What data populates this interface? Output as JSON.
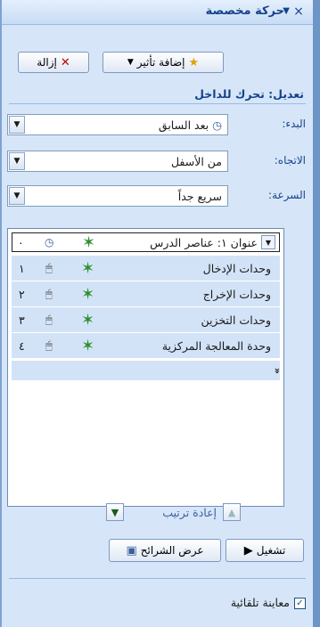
{
  "panel": {
    "title": "حركة مخصصة",
    "close_glyph": "×",
    "menu_glyph": "▼"
  },
  "toolbar": {
    "add_effect_label": "إضافة تأثير",
    "remove_label": "إزالة"
  },
  "section": {
    "title": "تعديل: تحرك للداخل"
  },
  "fields": {
    "start_label": "البدء:",
    "start_value": "بعد السابق",
    "direction_label": "الاتجاه:",
    "direction_value": "من الأسفل",
    "speed_label": "السرعة:",
    "speed_value": "سريع جداً"
  },
  "list": {
    "header_label": "عنوان ١: عناصر الدرس",
    "header_num": "٠",
    "items": [
      {
        "label": "وحدات الإدخال",
        "num": "١"
      },
      {
        "label": "وحدات الإخراج",
        "num": "٢"
      },
      {
        "label": "وحدات التخزين",
        "num": "٣"
      },
      {
        "label": "وحدة المعالجة المركزية",
        "num": "٤"
      }
    ],
    "collapse_glyph": "»"
  },
  "reorder": {
    "label": "إعادة ترتيب"
  },
  "actions": {
    "play_label": "تشغيل",
    "slideshow_label": "عرض الشرائح"
  },
  "autopreview": {
    "label": "معاينة تلقائية",
    "checked": true
  }
}
